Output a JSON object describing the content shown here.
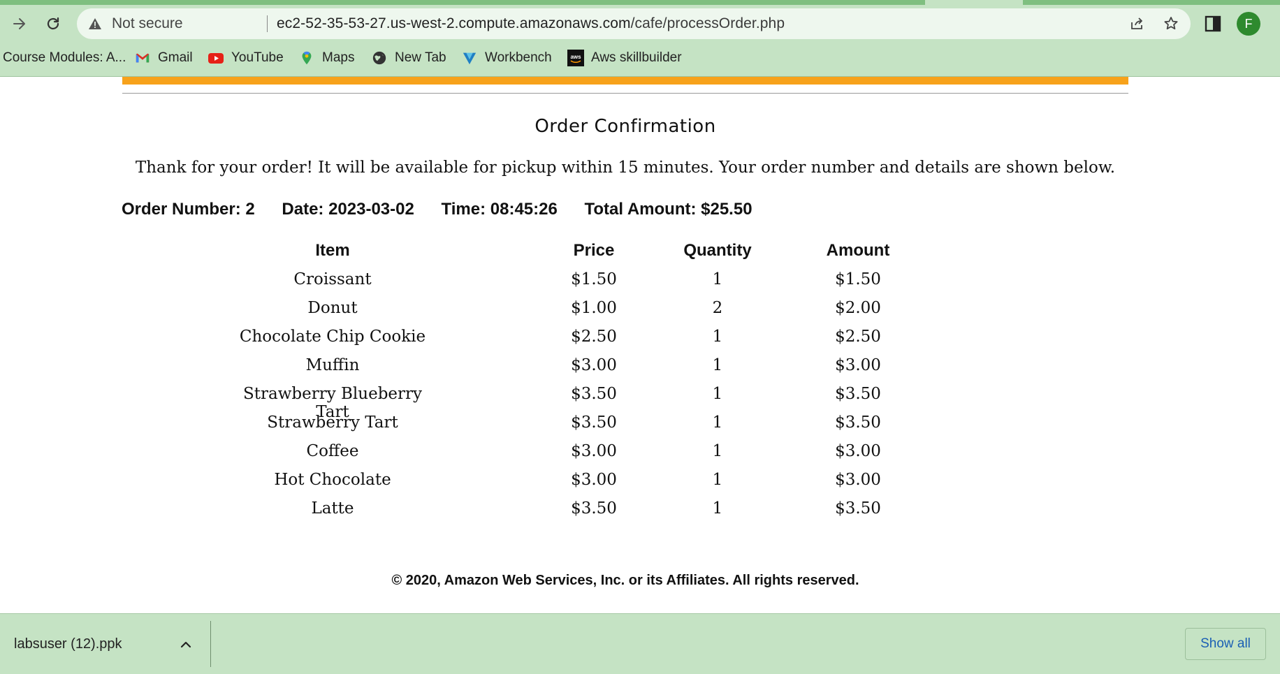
{
  "browser": {
    "security_label": "Not secure",
    "url_host": "ec2-52-35-53-27.us-west-2.compute.amazonaws.com",
    "url_path": "/cafe/processOrder.php",
    "profile_initial": "F",
    "bookmarks": [
      {
        "label": "Course Modules: A...",
        "icon": "none"
      },
      {
        "label": "Gmail",
        "icon": "gmail-icon"
      },
      {
        "label": "YouTube",
        "icon": "youtube-icon"
      },
      {
        "label": "Maps",
        "icon": "maps-icon"
      },
      {
        "label": "New Tab",
        "icon": "globe-icon"
      },
      {
        "label": "Workbench",
        "icon": "workbench-icon"
      },
      {
        "label": "Aws skillbuilder",
        "icon": "aws-icon"
      }
    ],
    "accent_color": "#c5e3c4"
  },
  "page": {
    "title": "Order Confirmation",
    "thanks": "Thank for your order! It will be available for pickup within 15 minutes. Your order number and details are shown below.",
    "summary": {
      "order_number": "Order Number: 2",
      "date": "Date: 2023-03-02",
      "time": "Time: 08:45:26",
      "total": "Total Amount: $25.50"
    },
    "table": {
      "headers": [
        "Item",
        "Price",
        "Quantity",
        "Amount"
      ],
      "rows": [
        [
          "Croissant",
          "$1.50",
          "1",
          "$1.50"
        ],
        [
          "Donut",
          "$1.00",
          "2",
          "$2.00"
        ],
        [
          "Chocolate Chip Cookie",
          "$2.50",
          "1",
          "$2.50"
        ],
        [
          "Muffin",
          "$3.00",
          "1",
          "$3.00"
        ],
        [
          "Strawberry Blueberry Tart",
          "$3.50",
          "1",
          "$3.50"
        ],
        [
          "Strawberry Tart",
          "$3.50",
          "1",
          "$3.50"
        ],
        [
          "Coffee",
          "$3.00",
          "1",
          "$3.00"
        ],
        [
          "Hot Chocolate",
          "$3.00",
          "1",
          "$3.00"
        ],
        [
          "Latte",
          "$3.50",
          "1",
          "$3.50"
        ]
      ]
    },
    "footer": "© 2020, Amazon Web Services, Inc. or its Affiliates. All rights reserved.",
    "banner_color": "#f7a21b"
  },
  "downloads": {
    "file_name": "labsuser (12).ppk",
    "show_all_label": "Show all"
  }
}
